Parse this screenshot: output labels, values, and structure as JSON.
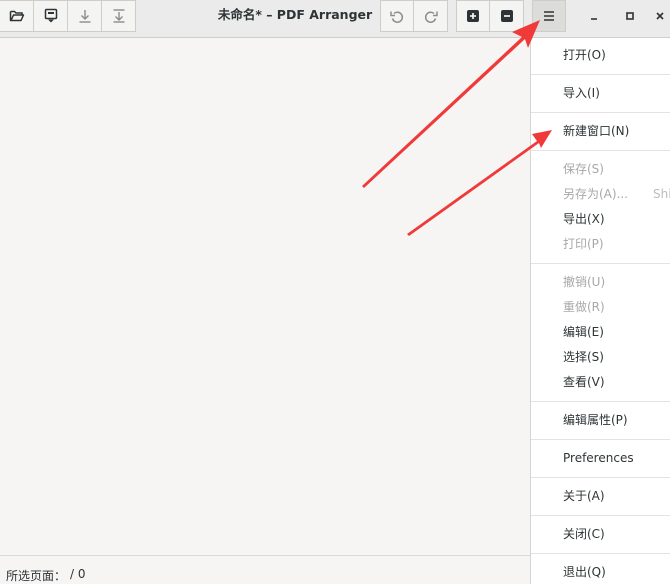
{
  "window": {
    "title": "未命名* – PDF Arranger"
  },
  "toolbar": {
    "buttons": [
      {
        "icon": "folder-open-icon"
      },
      {
        "icon": "save-down-icon"
      },
      {
        "icon": "download-icon"
      },
      {
        "icon": "import-icon"
      }
    ],
    "undo_icon": "undo-icon",
    "redo_icon": "redo-icon",
    "zoom_in_icon": "zoom-in-icon",
    "zoom_out_icon": "zoom-out-icon",
    "menu_icon": "hamburger-menu-icon"
  },
  "window_controls": [
    "minimize-icon",
    "maximize-icon",
    "close-icon"
  ],
  "statusbar": {
    "label": "所选页面：",
    "value": "/ 0"
  },
  "menu": {
    "items": [
      {
        "label": "打开(O)",
        "enabled": true
      },
      {
        "label": "导入(I)",
        "enabled": true
      },
      {
        "label": "新建窗口(N)",
        "enabled": true
      },
      {
        "label": "保存(S)",
        "enabled": false
      },
      {
        "label": "另存为(A)...",
        "enabled": false,
        "accel": "Shi"
      },
      {
        "label": "导出(X)",
        "enabled": true
      },
      {
        "label": "打印(P)",
        "enabled": false
      },
      {
        "label": "撤销(U)",
        "enabled": false
      },
      {
        "label": "重做(R)",
        "enabled": false
      },
      {
        "label": "编辑(E)",
        "enabled": true
      },
      {
        "label": "选择(S)",
        "enabled": true
      },
      {
        "label": "查看(V)",
        "enabled": true
      },
      {
        "label": "编辑属性(P)",
        "enabled": true
      },
      {
        "label": "Preferences",
        "enabled": true
      },
      {
        "label": "关于(A)",
        "enabled": true
      },
      {
        "label": "关闭(C)",
        "enabled": true
      },
      {
        "label": "退出(Q)",
        "enabled": true
      }
    ]
  },
  "colors": {
    "annotation_arrow": "#f03a3a",
    "headerbar": "#ebebeb",
    "canvas": "#f6f5f4",
    "menu_bg": "#ffffff"
  }
}
